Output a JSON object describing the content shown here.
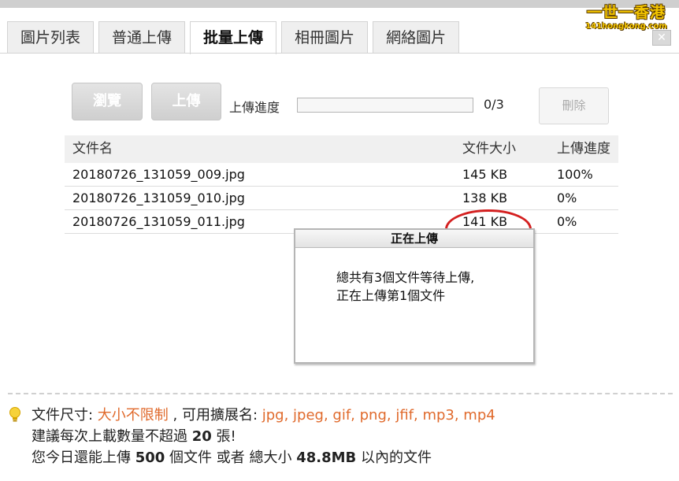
{
  "logo": {
    "main": "一世一香港",
    "sub": "141hongkong.com"
  },
  "tabs": [
    {
      "label": "圖片列表"
    },
    {
      "label": "普通上傳"
    },
    {
      "label": "批量上傳"
    },
    {
      "label": "相冊圖片"
    },
    {
      "label": "網絡圖片"
    }
  ],
  "toolbar": {
    "browse_label": "瀏覽",
    "upload_label": "上傳",
    "progress_label": "上傳進度",
    "progress_count": "0/3",
    "progress_value": 0,
    "delete_label": "刪除"
  },
  "table": {
    "headers": [
      "文件名",
      "文件大小",
      "上傳進度"
    ],
    "rows": [
      {
        "name": "20180726_131059_009.jpg",
        "size": "145 KB",
        "progress": "100%"
      },
      {
        "name": "20180726_131059_010.jpg",
        "size": "138 KB",
        "progress": "0%"
      },
      {
        "name": "20180726_131059_011.jpg",
        "size": "141 KB",
        "progress": "0%"
      }
    ]
  },
  "dialog": {
    "title": "正在上傳",
    "line1": "總共有3個文件等待上傳,",
    "line2": "正在上傳第1個文件"
  },
  "info": {
    "size_label": "文件尺寸: ",
    "size_value": "大小不限制",
    "ext_label": " , 可用擴展名: ",
    "ext_value": "jpg, jpeg, gif, png, jfif, mp3, mp4",
    "suggest_pre": "建議每次上載數量不超過 ",
    "suggest_num": "20",
    "suggest_post": " 張!",
    "today_pre": "您今日還能上傳 ",
    "today_num": "500",
    "today_mid": " 個文件 或者 總大小 ",
    "today_size": "48.8MB",
    "today_post": " 以內的文件"
  },
  "colors": {
    "accent": "#e06a2c",
    "highlight": "#d42020"
  }
}
